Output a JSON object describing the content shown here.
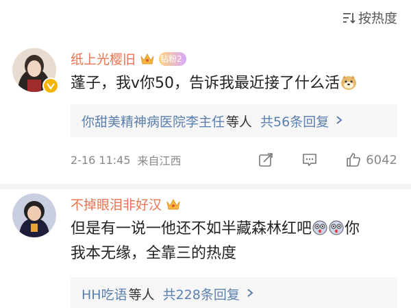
{
  "sort": {
    "label": "按热度"
  },
  "comments": [
    {
      "username": "纸上光樱旧",
      "fan_badge": "钻粉2",
      "text": "蓬子，我v你50，告诉我最近接了什么活",
      "reply_users": "你甜美精神病医院李主任",
      "reply_suffix": "等人",
      "reply_count": "共56条回复",
      "time": "2-16 11:45",
      "location": "来自江西",
      "likes": "6042"
    },
    {
      "username": "不掉眼泪非好汉",
      "text_line1": "但是有一说一他还不如半藏森林红吧",
      "text_line1_end": "你",
      "text_line2": "我本无缘，全靠三的热度",
      "reply_users": "HH吃语",
      "reply_suffix": "等人",
      "reply_count": "共228条回复"
    }
  ],
  "colors": {
    "username": "#eb7350",
    "link": "#5a7fae",
    "badge": "#f5b400"
  },
  "icons": [
    "sort-icon",
    "crown-icon",
    "verified-badge-icon",
    "doge-emoji-icon",
    "share-icon",
    "comment-icon",
    "like-icon",
    "surprised-emoji-icon",
    "chevron-right-icon"
  ]
}
